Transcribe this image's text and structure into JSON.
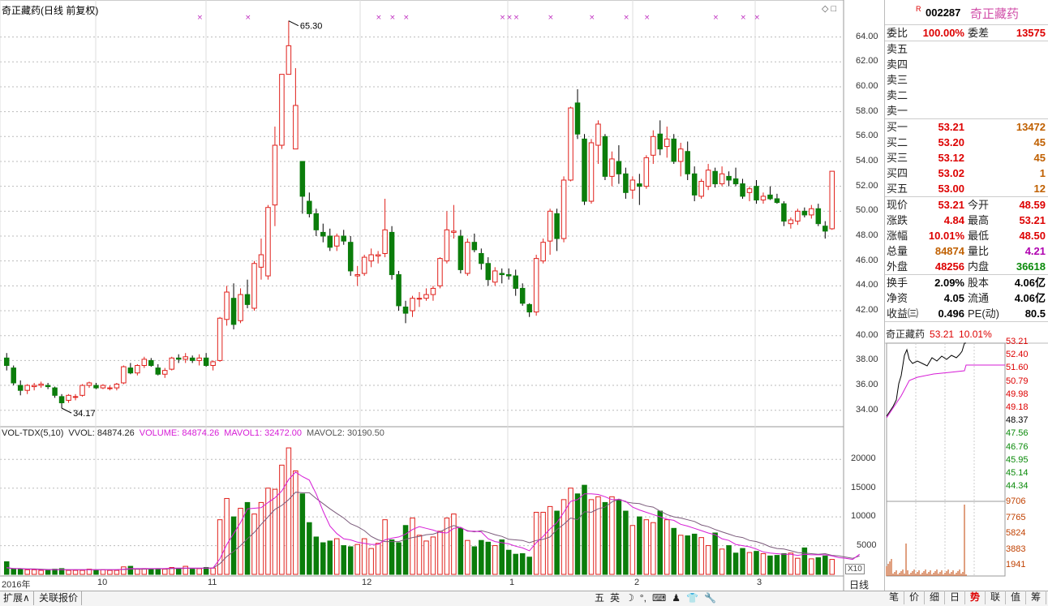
{
  "title": "奇正藏药(日线 前复权)",
  "price_labels": [
    "64.00",
    "62.00",
    "60.00",
    "58.00",
    "56.00",
    "54.00",
    "52.00",
    "50.00",
    "48.00",
    "46.00",
    "44.00",
    "42.00",
    "40.00",
    "38.00",
    "36.00",
    "34.00"
  ],
  "high_label": "65.30",
  "low_label": "34.17",
  "vol_legend": {
    "name": "VOL-TDX(5,10)",
    "vvol": "VVOL: 84874.26",
    "volume": "VOLUME: 84874.26",
    "mavol1": "MAVOL1: 32472.00",
    "mavol2": "MAVOL2: 30190.50"
  },
  "vol_axis": [
    "20000",
    "15000",
    "10000",
    "5000"
  ],
  "date_axis": [
    "2016年",
    "10",
    "11",
    "12",
    "1",
    "2",
    "3"
  ],
  "x10": "X10",
  "period": "日线",
  "header": {
    "r": "R",
    "code": "002287",
    "name": "奇正藏药"
  },
  "weibi": {
    "l1": "委比",
    "v1": "100.00%",
    "l2": "委差",
    "v2": "13575"
  },
  "sell": [
    {
      "label": "卖五",
      "price": "",
      "vol": ""
    },
    {
      "label": "卖四",
      "price": "",
      "vol": ""
    },
    {
      "label": "卖三",
      "price": "",
      "vol": ""
    },
    {
      "label": "卖二",
      "price": "",
      "vol": ""
    },
    {
      "label": "卖一",
      "price": "",
      "vol": ""
    }
  ],
  "buy": [
    {
      "label": "买一",
      "price": "53.21",
      "vol": "13472"
    },
    {
      "label": "买二",
      "price": "53.20",
      "vol": "45"
    },
    {
      "label": "买三",
      "price": "53.12",
      "vol": "45"
    },
    {
      "label": "买四",
      "price": "53.02",
      "vol": "1"
    },
    {
      "label": "买五",
      "price": "53.00",
      "vol": "12"
    }
  ],
  "quote": [
    {
      "l1": "现价",
      "v1": "53.21",
      "l2": "今开",
      "v2": "48.59"
    },
    {
      "l1": "涨跌",
      "v1": "4.84",
      "l2": "最高",
      "v2": "53.21"
    },
    {
      "l1": "涨幅",
      "v1": "10.01%",
      "l2": "最低",
      "v2": "48.50"
    },
    {
      "l1": "总量",
      "v1": "84874",
      "l2": "量比",
      "v2": "4.21"
    },
    {
      "l1": "外盘",
      "v1": "48256",
      "l2": "内盘",
      "v2": "36618"
    }
  ],
  "fund": [
    {
      "l1": "换手",
      "v1": "2.09%",
      "l2": "股本",
      "v2": "4.06亿"
    },
    {
      "l1": "净资",
      "v1": "4.05",
      "l2": "流通",
      "v2": "4.06亿"
    },
    {
      "l1": "收益㈢",
      "v1": "0.496",
      "l2": "PE(动)",
      "v2": "80.5"
    }
  ],
  "mini": {
    "name": "奇正藏药",
    "price": "53.21",
    "pct": "10.01%",
    "axis": [
      "53.21",
      "52.40",
      "51.60",
      "50.79",
      "49.98",
      "49.18",
      "48.37",
      "47.56",
      "46.76",
      "45.95",
      "45.14",
      "44.34"
    ],
    "vol_axis": [
      "9706",
      "7765",
      "5824",
      "3883",
      "1941"
    ]
  },
  "bottom_tabs": [
    "扩展∧",
    "关联报价"
  ],
  "ime": [
    "五",
    "英",
    "☽",
    "°,",
    "⌨",
    "♟",
    "👕",
    "🔧"
  ],
  "right_tabs": [
    "笔",
    "价",
    "细",
    "日",
    "势",
    "联",
    "值",
    "筹"
  ],
  "colors": {
    "up": "#e0201b",
    "down": "#0b7d0b",
    "ma1": "#d61cd6",
    "ma2": "#7a5a7a"
  },
  "chart_data": {
    "type": "candlestick",
    "title": "奇正藏药(日线 前复权)",
    "ylim": [
      33,
      65.8
    ],
    "ohlc": [
      [
        38.2,
        38.6,
        37.2,
        37.6
      ],
      [
        37.4,
        37.6,
        36.0,
        36.2
      ],
      [
        36.0,
        36.4,
        35.2,
        35.6
      ],
      [
        35.6,
        36.1,
        35.3,
        36.0
      ],
      [
        35.9,
        36.2,
        35.6,
        36.0
      ],
      [
        36.0,
        36.3,
        35.8,
        36.1
      ],
      [
        36.0,
        36.2,
        35.7,
        35.9
      ],
      [
        35.8,
        35.9,
        35.0,
        35.2
      ],
      [
        35.1,
        35.3,
        34.17,
        34.6
      ],
      [
        34.8,
        35.3,
        34.6,
        35.2
      ],
      [
        35.1,
        35.3,
        34.8,
        35.1
      ],
      [
        35.2,
        36.1,
        35.1,
        36.0
      ],
      [
        36.0,
        36.3,
        35.8,
        36.2
      ],
      [
        36.0,
        36.2,
        35.7,
        35.8
      ],
      [
        35.8,
        36.1,
        35.7,
        36.0
      ],
      [
        35.8,
        36.0,
        35.6,
        35.8
      ],
      [
        35.8,
        36.2,
        35.6,
        36.1
      ],
      [
        36.2,
        37.6,
        36.1,
        37.5
      ],
      [
        37.4,
        37.8,
        36.9,
        37.0
      ],
      [
        37.0,
        37.7,
        36.8,
        37.6
      ],
      [
        37.6,
        38.3,
        37.4,
        38.1
      ],
      [
        38.0,
        38.2,
        37.5,
        37.6
      ],
      [
        37.4,
        37.7,
        36.8,
        36.9
      ],
      [
        36.9,
        37.4,
        36.6,
        37.2
      ],
      [
        37.3,
        38.3,
        37.2,
        38.2
      ],
      [
        38.2,
        38.5,
        37.8,
        38.1
      ],
      [
        38.1,
        38.6,
        37.8,
        38.3
      ],
      [
        38.2,
        38.4,
        37.8,
        38.0
      ],
      [
        38.0,
        38.5,
        37.6,
        38.2
      ],
      [
        38.2,
        38.6,
        37.5,
        37.6
      ],
      [
        37.6,
        38.0,
        37.2,
        37.9
      ],
      [
        38.0,
        41.5,
        37.9,
        41.4
      ],
      [
        41.3,
        44.0,
        40.8,
        43.5
      ],
      [
        43.0,
        44.2,
        40.5,
        40.9
      ],
      [
        41.2,
        43.8,
        41.0,
        43.3
      ],
      [
        43.3,
        44.5,
        42.2,
        42.5
      ],
      [
        42.2,
        46.0,
        42.0,
        45.8
      ],
      [
        45.5,
        47.8,
        44.5,
        46.5
      ],
      [
        44.8,
        50.5,
        44.5,
        50.3
      ],
      [
        50.5,
        56.8,
        48.8,
        55.3
      ],
      [
        55.3,
        61.0,
        55.0,
        61.0
      ],
      [
        61.0,
        65.3,
        61.0,
        63.3
      ],
      [
        55.0,
        61.5,
        55.0,
        58.5
      ],
      [
        54.0,
        54.0,
        49.8,
        51.2
      ],
      [
        50.8,
        51.5,
        49.5,
        49.8
      ],
      [
        49.8,
        50.2,
        48.0,
        48.5
      ],
      [
        48.3,
        49.0,
        47.5,
        48.0
      ],
      [
        48.0,
        48.6,
        46.8,
        47.1
      ],
      [
        47.2,
        48.2,
        46.8,
        48.0
      ],
      [
        48.0,
        48.5,
        47.3,
        47.6
      ],
      [
        47.5,
        48.0,
        44.8,
        45.2
      ],
      [
        44.8,
        45.6,
        44.0,
        44.9
      ],
      [
        45.0,
        46.5,
        44.8,
        46.3
      ],
      [
        46.0,
        47.0,
        45.5,
        46.5
      ],
      [
        46.4,
        46.8,
        45.8,
        46.5
      ],
      [
        46.6,
        51.0,
        46.3,
        48.5
      ],
      [
        48.3,
        48.8,
        44.5,
        44.9
      ],
      [
        44.9,
        45.2,
        42.0,
        42.4
      ],
      [
        42.3,
        42.8,
        41.0,
        41.8
      ],
      [
        42.0,
        43.2,
        41.5,
        43.0
      ],
      [
        43.0,
        43.5,
        42.3,
        43.0
      ],
      [
        43.0,
        43.8,
        42.8,
        43.3
      ],
      [
        43.3,
        44.0,
        42.8,
        43.8
      ],
      [
        44.0,
        46.3,
        43.8,
        46.2
      ],
      [
        46.0,
        50.0,
        45.8,
        48.5
      ],
      [
        48.3,
        50.5,
        47.8,
        48.4
      ],
      [
        48.0,
        48.5,
        45.0,
        45.3
      ],
      [
        45.0,
        47.8,
        44.8,
        47.5
      ],
      [
        47.5,
        48.2,
        46.7,
        46.9
      ],
      [
        46.6,
        47.0,
        45.3,
        45.8
      ],
      [
        45.8,
        46.3,
        44.0,
        44.5
      ],
      [
        44.3,
        45.5,
        44.0,
        45.2
      ],
      [
        45.0,
        45.4,
        44.2,
        44.9
      ],
      [
        44.9,
        45.4,
        44.5,
        44.8
      ],
      [
        44.8,
        45.3,
        43.2,
        43.8
      ],
      [
        43.8,
        44.2,
        42.4,
        42.6
      ],
      [
        42.5,
        42.6,
        41.5,
        41.9
      ],
      [
        41.9,
        46.5,
        41.6,
        46.2
      ],
      [
        46.0,
        47.8,
        45.8,
        47.5
      ],
      [
        47.6,
        50.2,
        46.5,
        50.0
      ],
      [
        49.8,
        50.2,
        46.8,
        47.8
      ],
      [
        47.8,
        52.8,
        47.5,
        52.5
      ],
      [
        52.5,
        58.4,
        52.4,
        58.3
      ],
      [
        58.7,
        59.8,
        55.8,
        56.2
      ],
      [
        55.8,
        56.2,
        50.5,
        50.8
      ],
      [
        50.8,
        55.8,
        50.6,
        55.5
      ],
      [
        55.3,
        57.3,
        53.8,
        57.0
      ],
      [
        56.0,
        56.2,
        52.5,
        52.8
      ],
      [
        52.8,
        54.8,
        52.0,
        54.2
      ],
      [
        54.0,
        55.3,
        52.2,
        53.0
      ],
      [
        53.0,
        53.5,
        51.0,
        51.5
      ],
      [
        51.7,
        52.8,
        51.0,
        52.5
      ],
      [
        52.2,
        53.0,
        50.5,
        52.0
      ],
      [
        52.0,
        54.5,
        51.8,
        54.3
      ],
      [
        54.5,
        56.5,
        53.8,
        56.0
      ],
      [
        56.2,
        57.3,
        54.5,
        55.0
      ],
      [
        55.2,
        56.8,
        54.3,
        55.8
      ],
      [
        55.8,
        56.2,
        53.8,
        54.0
      ],
      [
        54.0,
        55.5,
        52.8,
        55.0
      ],
      [
        54.8,
        55.6,
        52.5,
        53.0
      ],
      [
        53.0,
        53.6,
        50.8,
        51.3
      ],
      [
        51.2,
        52.6,
        51.0,
        52.4
      ],
      [
        52.0,
        53.8,
        51.7,
        53.3
      ],
      [
        53.2,
        53.5,
        51.9,
        52.2
      ],
      [
        52.2,
        53.6,
        52.0,
        53.0
      ],
      [
        52.8,
        53.2,
        52.0,
        52.5
      ],
      [
        52.6,
        53.5,
        52.0,
        52.2
      ],
      [
        52.2,
        52.6,
        51.0,
        51.2
      ],
      [
        51.5,
        52.0,
        50.8,
        51.8
      ],
      [
        52.0,
        52.5,
        50.6,
        50.9
      ],
      [
        50.9,
        51.5,
        50.6,
        51.2
      ],
      [
        51.3,
        52.0,
        50.9,
        51.0
      ],
      [
        51.0,
        51.4,
        50.6,
        50.7
      ],
      [
        50.6,
        50.8,
        48.8,
        49.2
      ],
      [
        49.0,
        49.5,
        48.6,
        49.3
      ],
      [
        49.2,
        50.2,
        48.9,
        50.0
      ],
      [
        50.0,
        50.3,
        49.5,
        49.7
      ],
      [
        49.7,
        50.5,
        49.4,
        50.2
      ],
      [
        50.2,
        50.6,
        48.8,
        49.0
      ],
      [
        48.8,
        49.2,
        47.8,
        48.4
      ],
      [
        48.59,
        53.21,
        48.5,
        53.21
      ]
    ],
    "volume": [
      2200,
      1000,
      900,
      800,
      800,
      700,
      700,
      900,
      1000,
      700,
      700,
      700,
      900,
      700,
      800,
      700,
      700,
      1300,
      1400,
      900,
      1000,
      900,
      1000,
      900,
      1200,
      1000,
      1400,
      900,
      1000,
      1200,
      1100,
      9500,
      13200,
      10000,
      11500,
      12500,
      10500,
      12500,
      15000,
      14800,
      19000,
      22000,
      18000,
      14000,
      9000,
      6500,
      5500,
      5800,
      6200,
      5000,
      4800,
      5200,
      6200,
      4500,
      5400,
      9500,
      6000,
      5500,
      8500,
      9800,
      6800,
      5800,
      6500,
      7500,
      9800,
      10500,
      8000,
      5900,
      4800,
      5900,
      5600,
      5000,
      6000,
      4200,
      3500,
      3600,
      3000,
      10800,
      10800,
      11800,
      11000,
      13000,
      15000,
      14000,
      15500,
      13000,
      13500,
      12500,
      13500,
      13000,
      11000,
      8500,
      10000,
      9500,
      9000,
      11000,
      9500,
      8000,
      6800,
      6700,
      7000,
      6400,
      5000,
      7200,
      4400,
      5000,
      3700,
      4500,
      3800,
      4000,
      3600,
      3200,
      3300,
      3600,
      3700,
      2800,
      4600,
      2700,
      2900,
      3200,
      2600,
      2600,
      2500,
      2100,
      8500
    ],
    "mavol1": [
      1200,
      1000,
      1000,
      900,
      900,
      800,
      800,
      800,
      800,
      800,
      800,
      800,
      800,
      800,
      800,
      800,
      800,
      900,
      1000,
      1000,
      1000,
      1000,
      1000,
      1000,
      1100,
      1100,
      1100,
      1100,
      1100,
      1100,
      1100,
      2700,
      5200,
      7100,
      9000,
      11400,
      11500,
      11600,
      12500,
      13300,
      14500,
      16500,
      17800,
      17000,
      16400,
      14000,
      11000,
      8400,
      7100,
      6200,
      6000,
      5600,
      5400,
      5200,
      5200,
      6000,
      6300,
      6500,
      7000,
      7800,
      8300,
      8000,
      7700,
      7300,
      7200,
      8000,
      8200,
      7500,
      7500,
      7400,
      6200,
      5700,
      5500,
      5300,
      4900,
      4600,
      4100,
      5500,
      6600,
      7900,
      9000,
      10800,
      12700,
      13000,
      14000,
      14000,
      13900,
      13500,
      13000,
      13000,
      12700,
      11700,
      11200,
      10800,
      10400,
      10000,
      9600,
      9400,
      8700,
      8400,
      8000,
      7600,
      7200,
      6900,
      6200,
      5900,
      5200,
      5000,
      4800,
      4400,
      3900,
      3700,
      3600,
      3500,
      3500,
      3300,
      3500,
      3400,
      3400,
      3400,
      3200,
      2900,
      2800,
      2600,
      3500
    ],
    "mavol2": [
      1100,
      1000,
      1000,
      950,
      950,
      900,
      850,
      850,
      850,
      800,
      800,
      800,
      800,
      800,
      800,
      800,
      800,
      850,
      900,
      900,
      900,
      950,
      950,
      950,
      1000,
      1000,
      1050,
      1050,
      1050,
      1100,
      1100,
      1850,
      3100,
      4000,
      5000,
      6200,
      7300,
      8700,
      10000,
      11300,
      12000,
      13000,
      14300,
      14200,
      14200,
      13200,
      12300,
      11400,
      10600,
      9800,
      8800,
      8300,
      7600,
      6600,
      6000,
      5700,
      5700,
      5700,
      6100,
      6400,
      6600,
      6900,
      7000,
      7400,
      8000,
      8500,
      8100,
      7600,
      7400,
      7600,
      7300,
      6900,
      6600,
      6100,
      6000,
      5900,
      5500,
      5900,
      6100,
      6500,
      7800,
      8700,
      9800,
      9500,
      10900,
      10800,
      11400,
      11700,
      12600,
      13100,
      12600,
      12400,
      12300,
      11900,
      11700,
      11000,
      10400,
      10000,
      9800,
      9500,
      9200,
      8600,
      8300,
      7800,
      7400,
      7000,
      6600,
      6400,
      5900,
      5700,
      5300,
      4800,
      4500,
      4400,
      4100,
      3800,
      3700,
      3600,
      3500,
      3600,
      3300,
      3200,
      3000,
      2800,
      3200
    ]
  }
}
